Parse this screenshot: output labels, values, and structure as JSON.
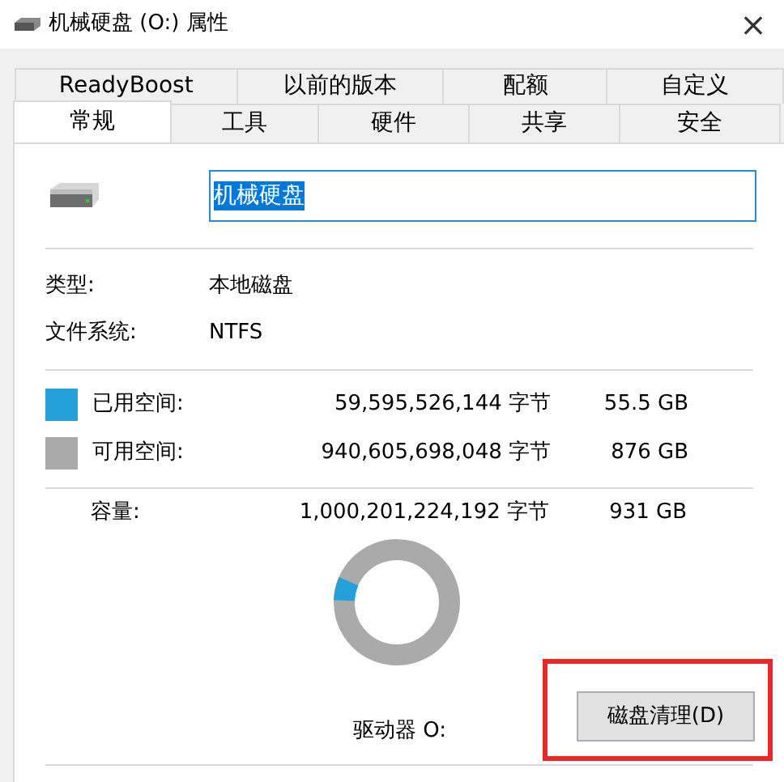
{
  "window": {
    "title": "机械硬盘 (O:) 属性",
    "close": "×"
  },
  "tabs": [
    [
      {
        "label": "ReadyBoost",
        "selected": false
      },
      {
        "label": "以前的版本",
        "selected": false
      },
      {
        "label": "配额",
        "selected": false
      },
      {
        "label": "自定义",
        "selected": false
      }
    ],
    [
      {
        "label": "常规",
        "selected": true
      },
      {
        "label": "工具",
        "selected": false
      },
      {
        "label": "硬件",
        "selected": false
      },
      {
        "label": "共享",
        "selected": false
      },
      {
        "label": "安全",
        "selected": false
      }
    ]
  ],
  "name_field": {
    "value": "机械硬盘"
  },
  "info": [
    {
      "label": "类型:",
      "value": "本地磁盘"
    },
    {
      "label": "文件系统:",
      "value": "NTFS"
    }
  ],
  "space": [
    {
      "label": "已用空间:",
      "bytes": "59,595,526,144 字节",
      "size": "55.5 GB",
      "color": "#26a0da"
    },
    {
      "label": "可用空间:",
      "bytes": "940,605,698,048 字节",
      "size": "876 GB",
      "color": "#aaaaaa"
    }
  ],
  "capacity": {
    "label": "容量:",
    "bytes": "1,000,201,224,192 字节",
    "size": "931 GB"
  },
  "usage": {
    "level": 0.06
  },
  "drive_label": "驱动器 O:",
  "cleanup_button": {
    "label": "磁盘清理(D)",
    "highlighted": true
  }
}
